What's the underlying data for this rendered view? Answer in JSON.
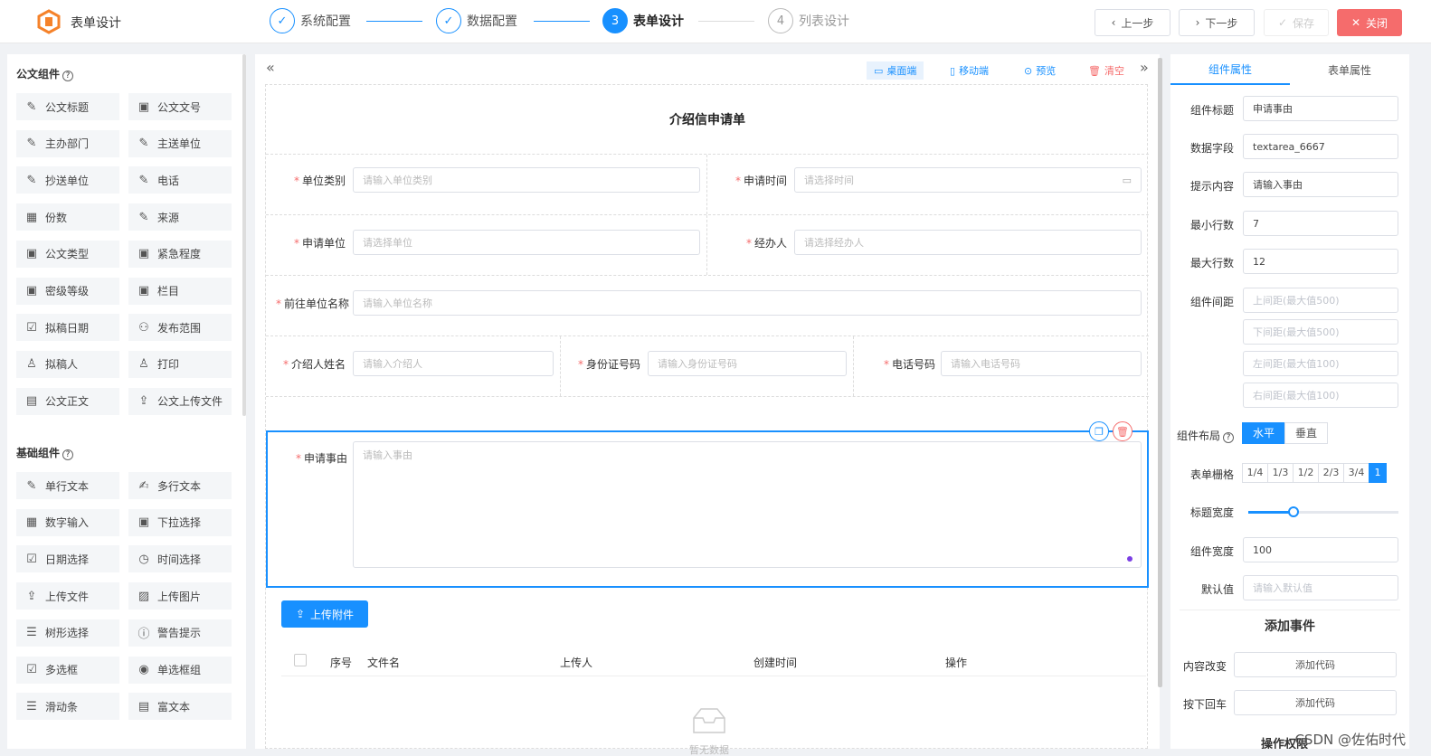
{
  "app": {
    "title": "表单设计"
  },
  "steps": [
    {
      "num": "✓",
      "label": "系统配置",
      "state": "done"
    },
    {
      "num": "✓",
      "label": "数据配置",
      "state": "done"
    },
    {
      "num": "3",
      "label": "表单设计",
      "state": "active"
    },
    {
      "num": "4",
      "label": "列表设计",
      "state": "wait"
    }
  ],
  "toolbar": {
    "prev": "上一步",
    "next": "下一步",
    "save": "保存",
    "close": "关闭"
  },
  "left": {
    "section1": "公文组件",
    "section1_items": [
      {
        "icon": "✎",
        "label": "公文标题"
      },
      {
        "icon": "▣",
        "label": "公文文号"
      },
      {
        "icon": "✎",
        "label": "主办部门"
      },
      {
        "icon": "✎",
        "label": "主送单位"
      },
      {
        "icon": "✎",
        "label": "抄送单位"
      },
      {
        "icon": "✎",
        "label": "电话"
      },
      {
        "icon": "▦",
        "label": "份数"
      },
      {
        "icon": "✎",
        "label": "来源"
      },
      {
        "icon": "▣",
        "label": "公文类型"
      },
      {
        "icon": "▣",
        "label": "紧急程度"
      },
      {
        "icon": "▣",
        "label": "密级等级"
      },
      {
        "icon": "▣",
        "label": "栏目"
      },
      {
        "icon": "☑",
        "label": "拟稿日期"
      },
      {
        "icon": "⚇",
        "label": "发布范围"
      },
      {
        "icon": "♙",
        "label": "拟稿人"
      },
      {
        "icon": "♙",
        "label": "打印"
      },
      {
        "icon": "▤",
        "label": "公文正文"
      },
      {
        "icon": "⇪",
        "label": "公文上传文件"
      }
    ],
    "section2": "基础组件",
    "section2_items": [
      {
        "icon": "✎",
        "label": "单行文本"
      },
      {
        "icon": "✍",
        "label": "多行文本"
      },
      {
        "icon": "▦",
        "label": "数字输入"
      },
      {
        "icon": "▣",
        "label": "下拉选择"
      },
      {
        "icon": "☑",
        "label": "日期选择"
      },
      {
        "icon": "◷",
        "label": "时间选择"
      },
      {
        "icon": "⇪",
        "label": "上传文件"
      },
      {
        "icon": "▨",
        "label": "上传图片"
      },
      {
        "icon": "☰",
        "label": "树形选择"
      },
      {
        "icon": "ⓘ",
        "label": "警告提示"
      },
      {
        "icon": "☑",
        "label": "多选框"
      },
      {
        "icon": "◉",
        "label": "单选框组"
      },
      {
        "icon": "☰",
        "label": "滑动条"
      },
      {
        "icon": "▤",
        "label": "富文本"
      }
    ]
  },
  "center": {
    "tools": {
      "desktop": "桌面端",
      "mobile": "移动端",
      "preview": "预览",
      "clear": "清空"
    },
    "form_title": "介绍信申请单",
    "fields": {
      "unit_type": {
        "label": "单位类别",
        "placeholder": "请输入单位类别"
      },
      "apply_time": {
        "label": "申请时间",
        "placeholder": "请选择时间"
      },
      "apply_unit": {
        "label": "申请单位",
        "placeholder": "请选择单位"
      },
      "handler": {
        "label": "经办人",
        "placeholder": "请选择经办人"
      },
      "dest_unit": {
        "label": "前往单位名称",
        "placeholder": "请输入单位名称"
      },
      "introducee": {
        "label": "介绍人姓名",
        "placeholder": "请输入介绍人"
      },
      "id_number": {
        "label": "身份证号码",
        "placeholder": "请输入身份证号码"
      },
      "phone": {
        "label": "电话号码",
        "placeholder": "请输入电话号码"
      },
      "reason": {
        "label": "申请事由",
        "placeholder": "请输入事由"
      }
    },
    "upload_btn": "上传附件",
    "table_headers": [
      "序号",
      "文件名",
      "上传人",
      "创建时间",
      "操作"
    ],
    "empty_text": "暂无数据"
  },
  "right": {
    "tabs": [
      "组件属性",
      "表单属性"
    ],
    "props": {
      "title_label": "组件标题",
      "title_value": "申请事由",
      "field_label": "数据字段",
      "field_value": "textarea_6667",
      "hint_label": "提示内容",
      "hint_value": "请输入事由",
      "minrows_label": "最小行数",
      "minrows_value": "7",
      "maxrows_label": "最大行数",
      "maxrows_value": "12",
      "spacing_label": "组件间距",
      "spacing_top": "上间距(最大值500)",
      "spacing_bottom": "下间距(最大值500)",
      "spacing_left": "左间距(最大值100)",
      "spacing_right": "右间距(最大值100)",
      "layout_label": "组件布局",
      "layout_h": "水平",
      "layout_v": "垂直",
      "grid_label": "表单栅格",
      "grid_options": [
        "1/4",
        "1/3",
        "1/2",
        "2/3",
        "3/4",
        "1"
      ],
      "labelwidth_label": "标题宽度",
      "labelwidth_value": 0.3,
      "width_label": "组件宽度",
      "width_value": "100",
      "default_label": "默认值",
      "default_placeholder": "请输入默认值"
    },
    "events_title": "添加事件",
    "events": [
      {
        "label": "内容改变",
        "btn": "添加代码"
      },
      {
        "label": "按下回车",
        "btn": "添加代码"
      }
    ],
    "bottom_cut": "操作权限"
  },
  "watermark": "CSDN @佐佑时代",
  "colors": {
    "primary": "#1890ff",
    "danger": "#f56c6c"
  }
}
